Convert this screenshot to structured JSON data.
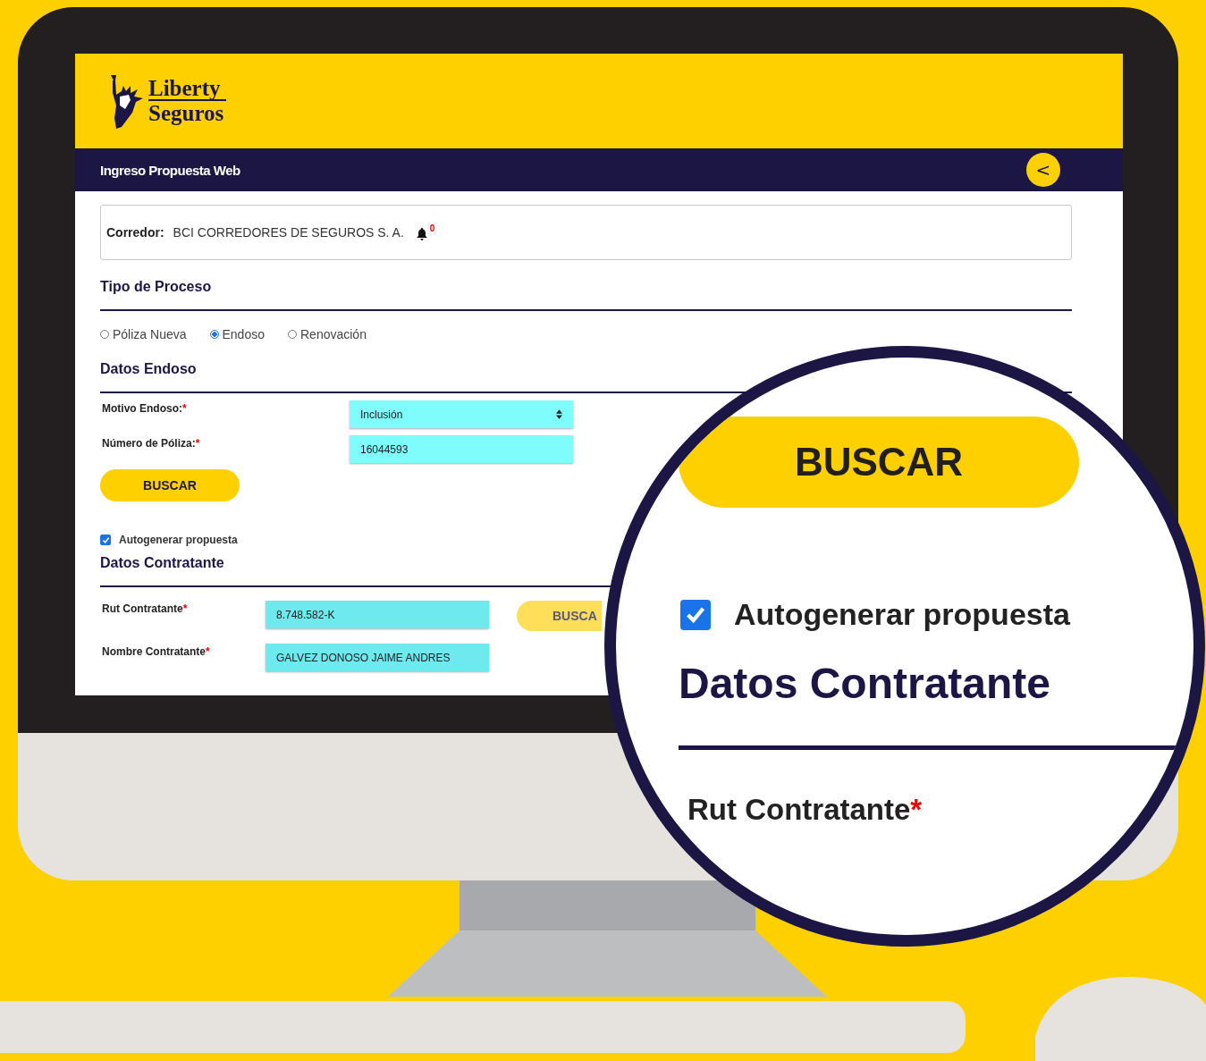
{
  "logo": {
    "lines": [
      "Liberty",
      "Seguros"
    ]
  },
  "nav": {
    "title": "Ingreso Propuesta Web",
    "back": "<"
  },
  "broker": {
    "label": "Corredor:",
    "value": "BCI CORREDORES DE SEGUROS S. A.",
    "notifications": "0"
  },
  "process": {
    "title": "Tipo de Proceso",
    "options": [
      {
        "label": "Póliza Nueva",
        "selected": false
      },
      {
        "label": "Endoso",
        "selected": true
      },
      {
        "label": "Renovación",
        "selected": false
      }
    ]
  },
  "endorsement": {
    "title": "Datos Endoso",
    "fields": [
      {
        "kind": "select",
        "label": "Motivo Endoso:",
        "mark": "*",
        "value": "Inclusión"
      },
      {
        "kind": "input",
        "label": "Número de Póliza:",
        "mark": "*",
        "value": "16044593"
      }
    ],
    "button": {
      "label": "BUSCAR",
      "disabled": false
    }
  },
  "autogenerate": {
    "label": "Autogenerar propuesta",
    "checked": true
  },
  "contractor": {
    "title": "Datos Contratante",
    "fields": [
      {
        "kind": "input",
        "label": "Rut Contratante",
        "mark": "*",
        "value": "8.748.582-K"
      },
      {
        "kind": "input",
        "label": "Nombre Contratante",
        "mark": "*",
        "value": "GALVEZ DONOSO JAIME ANDRES"
      }
    ],
    "button": {
      "label": "BUSCA",
      "disabled": true
    }
  },
  "magnifier": {
    "button": {
      "label": "BUSCAR",
      "disabled": false
    },
    "checkbox": {
      "label": "Autogenerar propuesta",
      "checked": true
    },
    "title": "Datos Contratante",
    "field_label": {
      "label": "Rut Contratante",
      "mark": "*"
    }
  }
}
